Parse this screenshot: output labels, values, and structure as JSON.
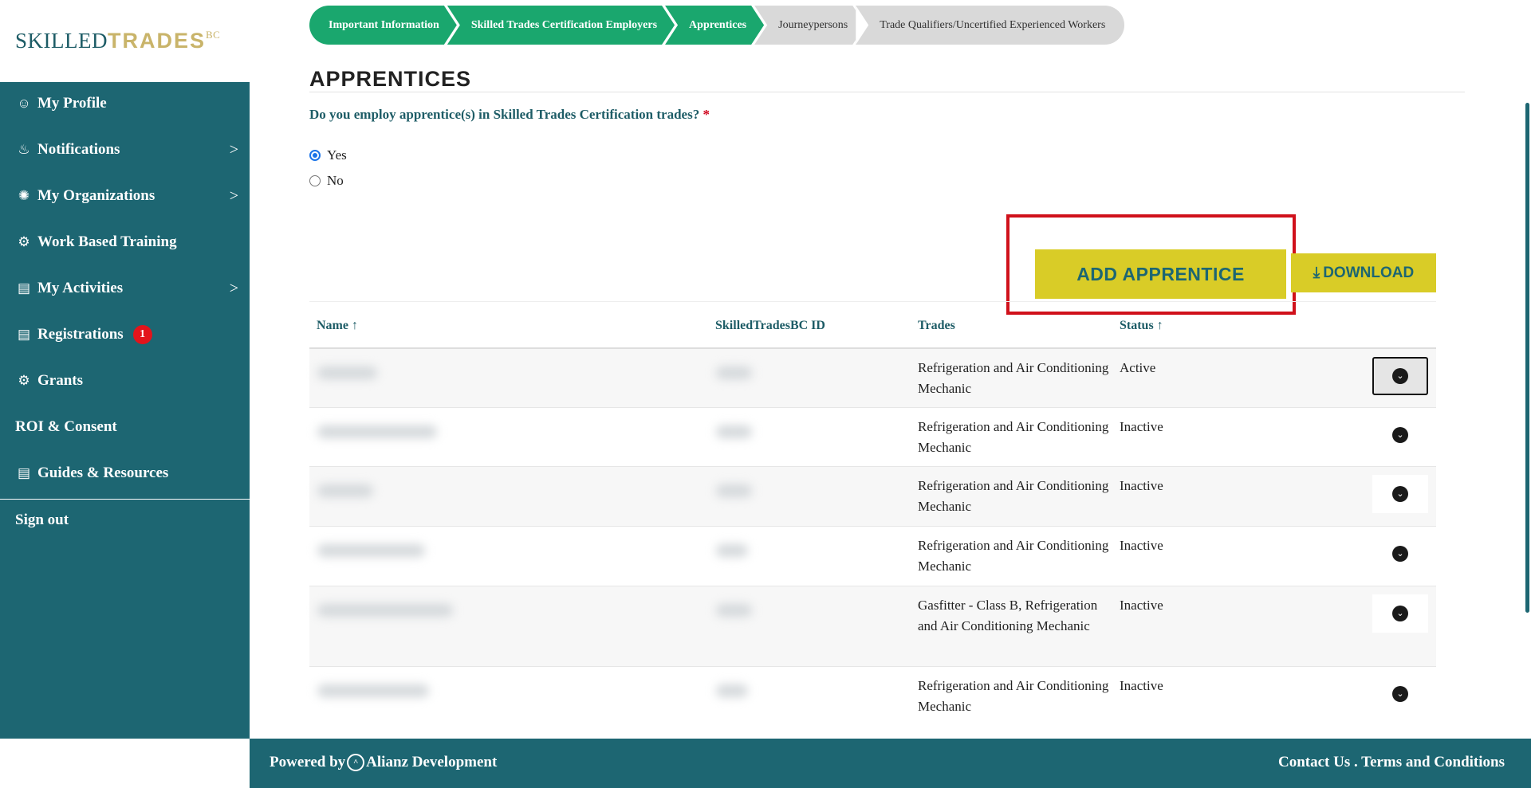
{
  "logo": {
    "part1": "SKILLED",
    "part2": "TRADES",
    "part3": "BC"
  },
  "sidebar": {
    "items": [
      {
        "label": "My Profile",
        "icon": "users-icon",
        "chevron": false
      },
      {
        "label": "Notifications",
        "icon": "bell-icon",
        "chevron": true
      },
      {
        "label": "My Organizations",
        "icon": "network-icon",
        "chevron": true
      },
      {
        "label": "Work Based Training",
        "icon": "gears-icon",
        "chevron": false
      },
      {
        "label": "My Activities",
        "icon": "laptop-icon",
        "chevron": true
      },
      {
        "label": "Registrations",
        "icon": "registration-icon",
        "chevron": false,
        "badge": "1"
      },
      {
        "label": "Grants",
        "icon": "gears-icon",
        "chevron": false
      },
      {
        "label": "ROI & Consent",
        "chevron": false
      },
      {
        "label": "Guides & Resources",
        "icon": "book-icon",
        "chevron": false
      }
    ],
    "signout": "Sign out"
  },
  "steps": [
    {
      "label": "Important Information",
      "status": "done"
    },
    {
      "label": "Skilled Trades Certification Employers",
      "status": "done"
    },
    {
      "label": "Apprentices",
      "status": "done"
    },
    {
      "label": "Journeypersons",
      "status": "todo"
    },
    {
      "label": "Trade Qualifiers/Uncertified Experienced Workers",
      "status": "todo"
    }
  ],
  "page": {
    "title": "APPRENTICES",
    "question": "Do you employ apprentice(s) in Skilled Trades Certification trades?",
    "required": "*",
    "options": [
      "Yes",
      "No"
    ],
    "selected": "Yes"
  },
  "buttons": {
    "add": "ADD APPRENTICE",
    "download": "DOWNLOAD"
  },
  "table": {
    "headers": {
      "name": "Name",
      "id": "SkilledTradesBC ID",
      "trades": "Trades",
      "status": "Status"
    },
    "sort_arrow": "↑",
    "rows": [
      {
        "trades": "Refrigeration and Air Conditioning Mechanic",
        "status": "Active"
      },
      {
        "trades": "Refrigeration and Air Conditioning Mechanic",
        "status": "Inactive"
      },
      {
        "trades": "Refrigeration and Air Conditioning Mechanic",
        "status": "Inactive"
      },
      {
        "trades": "Refrigeration and Air Conditioning Mechanic",
        "status": "Inactive"
      },
      {
        "trades": "Gasfitter - Class B, Refrigeration and Air Conditioning Mechanic",
        "status": "Inactive"
      },
      {
        "trades": "Refrigeration and Air Conditioning Mechanic",
        "status": "Inactive"
      }
    ]
  },
  "footer": {
    "powered": "Powered by",
    "company": "Alianz Development",
    "contact": "Contact Us",
    "sep": " . ",
    "terms": "Terms and Conditions"
  },
  "colors": {
    "sidebar": "#1d6672",
    "step_done": "#1aa76e",
    "step_todo": "#d9d9d9",
    "button": "#d9cc27",
    "highlight": "#d0111b"
  }
}
